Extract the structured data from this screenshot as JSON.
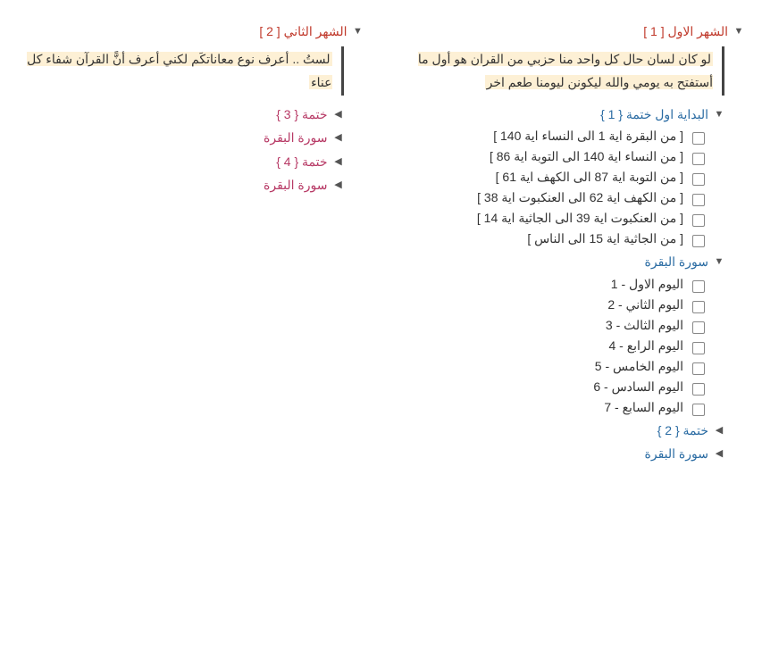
{
  "col1": {
    "month_title": "الشهر الاول [ 1 ]",
    "quote": "لو كان لسان حال كل واحد منا حزبي من القران هو أول ما أستفتح به يومي والله ليكونن ليومنا طعم اخر",
    "section1_title": "البداية اول ختمة { 1 }",
    "section1_items": [
      "[ من البقرة اية 1 الى النساء اية 140 ]",
      "[ من النساء اية 140 الى التوبة اية 86 ]",
      "[ من التوبة اية 87 الى الكهف اية 61 ]",
      "[ من الكهف اية 62 الى العنكبوت اية 38 ]",
      "[ من العنكبوت اية 39 الى الجاثية اية 14 ]",
      "[ من الجاثية اية 15 الى الناس ]"
    ],
    "section2_title": "سورة البقرة",
    "section2_items": [
      "اليوم الاول - 1",
      "اليوم الثاني - 2",
      "اليوم الثالث - 3",
      "اليوم الرابع - 4",
      "اليوم الخامس  - 5",
      "اليوم السادس - 6",
      "اليوم السابع - 7"
    ],
    "section3_title": "ختمة  { 2 }",
    "section4_title": "سورة البقرة"
  },
  "col2": {
    "month_title": "الشهر الثاني [ 2 ]",
    "quote": "لستُ .. أعرف نوع معاناتكَم لكني أعرف أنًّ القرآن شفاء كل عناء",
    "items": [
      "ختمة  { 3 }",
      "سورة البقرة",
      "ختمة  { 4 }",
      "سورة البقرة"
    ]
  }
}
